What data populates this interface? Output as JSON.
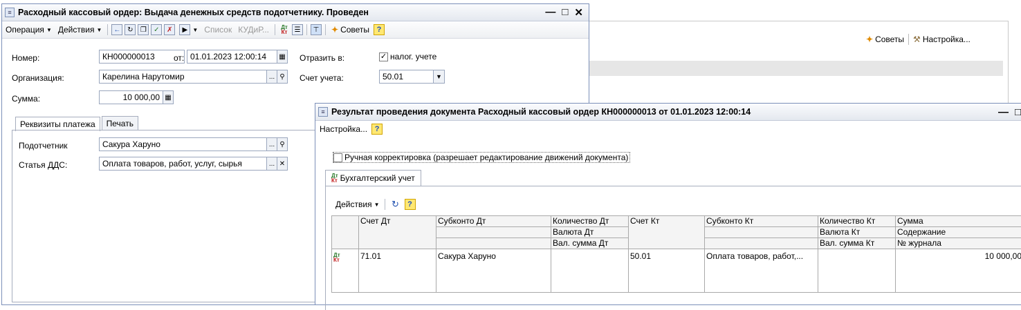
{
  "bg_app": {
    "tips_label": "Советы",
    "settings_label": "Настройка..."
  },
  "order_window": {
    "title": "Расходный кассовый ордер: Выдача денежных средств подотчетнику. Проведен",
    "toolbar": {
      "operation": "Операция",
      "actions": "Действия",
      "list": "Список",
      "kudir": "КУДиР...",
      "tips": "Советы"
    },
    "number_label": "Номер:",
    "number_value": "КН000000013",
    "date_label": "от:",
    "date_value": "01.01.2023 12:00:14",
    "reflect_label": "Отразить в:",
    "tax_accounting_label": "налог. учете",
    "tax_accounting_checked": true,
    "org_label": "Организация:",
    "org_value": "Карелина Нарутомир",
    "account_label": "Счет учета:",
    "account_value": "50.01",
    "sum_label": "Сумма:",
    "sum_value": "10 000,00",
    "tabs": [
      "Реквизиты платежа",
      "Печать"
    ],
    "employee_label": "Подотчетник",
    "employee_value": "Сакура Харуно",
    "dds_label": "Статья ДДС:",
    "dds_value": "Оплата товаров, работ, услуг, сырья"
  },
  "result_window": {
    "title": "Результат проведения документа Расходный кассовый ордер КН000000013 от 01.01.2023 12:00:14",
    "settings_label": "Настройка...",
    "manual_label": "Ручная корректировка (разрешает редактирование движений документа)",
    "manual_checked": false,
    "tab_label": "Бухгалтерский учет",
    "actions_label": "Действия",
    "columns": {
      "debit_account": "Счет Дт",
      "debit_subconto": "Субконто Дт",
      "debit_qty": "Количество Дт",
      "debit_currency": "Валюта Дт",
      "debit_cur_sum": "Вал. сумма Дт",
      "credit_account": "Счет Кт",
      "credit_subconto": "Субконто Кт",
      "credit_qty": "Количество Кт",
      "credit_currency": "Валюта Кт",
      "credit_cur_sum": "Вал. сумма Кт",
      "sum": "Сумма",
      "content": "Содержание",
      "journal": "№ журнала"
    },
    "row": {
      "debit_account": "71.01",
      "debit_subconto": "Сакура Харуно",
      "credit_account": "50.01",
      "credit_subconto": "Оплата товаров, работ,...",
      "sum": "10 000,00"
    }
  }
}
